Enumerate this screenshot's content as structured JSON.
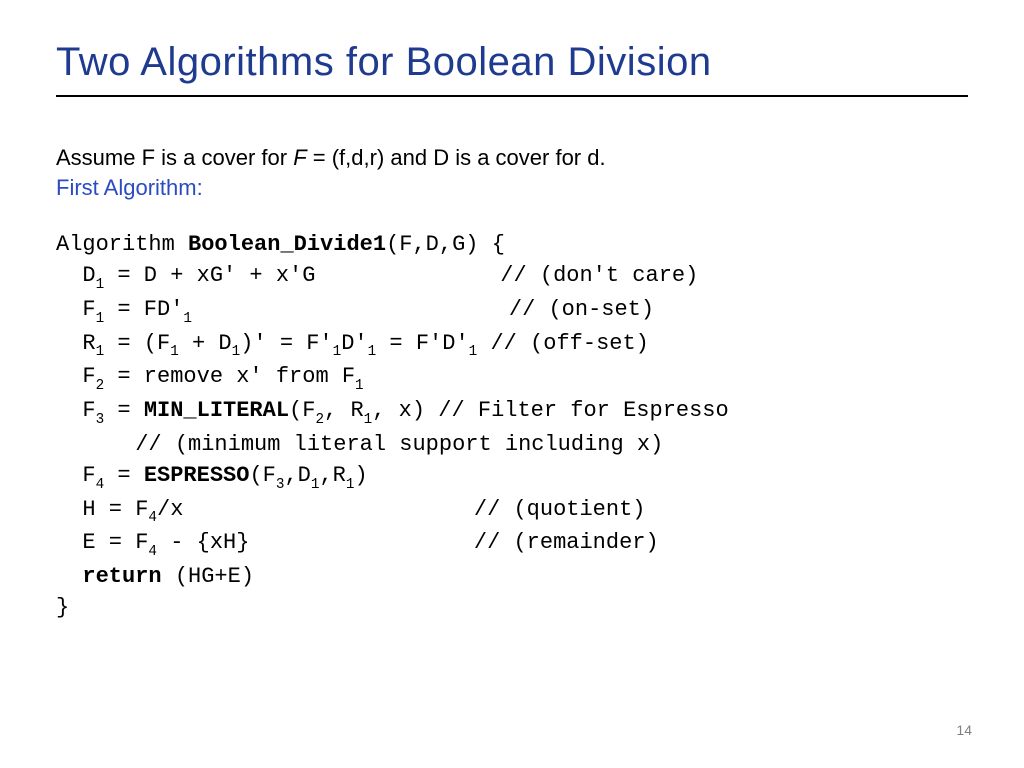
{
  "title": "Two Algorithms for Boolean Division",
  "intro_prefix": "Assume F is a cover for ",
  "intro_italic": "F",
  "intro_suffix": " = (f,d,r) and D is a cover for d.",
  "first_algo_label": "First Algorithm:",
  "code": {
    "sig_pre": "Algorithm ",
    "sig_name": "Boolean_Divide1",
    "sig_args": "(F,D,G) {",
    "l1a": "  D",
    "l1b": " = D + xG' + x'G              // (don't care)",
    "l2a": "  F",
    "l2b": " = FD'",
    "l2c": "                        // (on-set)",
    "l3a": "  R",
    "l3b": " = (F",
    "l3c": " + D",
    "l3d": ")' = F'",
    "l3e": "D'",
    "l3f": " = F'D'",
    "l3g": " // (off-set)",
    "l4a": "  F",
    "l4b": " = remove x' from F",
    "l5a": "  F",
    "l5b": " = ",
    "l5fn": "MIN_LITERAL",
    "l5c": "(F",
    "l5d": ", R",
    "l5e": ", x) // Filter for Espresso",
    "l6": "      // (minimum literal support including x)",
    "l7a": "  F",
    "l7b": " = ",
    "l7fn": "ESPRESSO",
    "l7c": "(F",
    "l7d": ",D",
    "l7e": ",R",
    "l7f": ")",
    "l8a": "  H = F",
    "l8b": "/x                      // (quotient)",
    "l9a": "  E = F",
    "l9b": " - {xH}                 // (remainder)",
    "l10a": "  ",
    "l10kw": "return",
    "l10b": " (HG+E)",
    "l11": "}"
  },
  "subs": {
    "one": "1",
    "two": "2",
    "three": "3",
    "four": "4"
  },
  "page_number": "14"
}
